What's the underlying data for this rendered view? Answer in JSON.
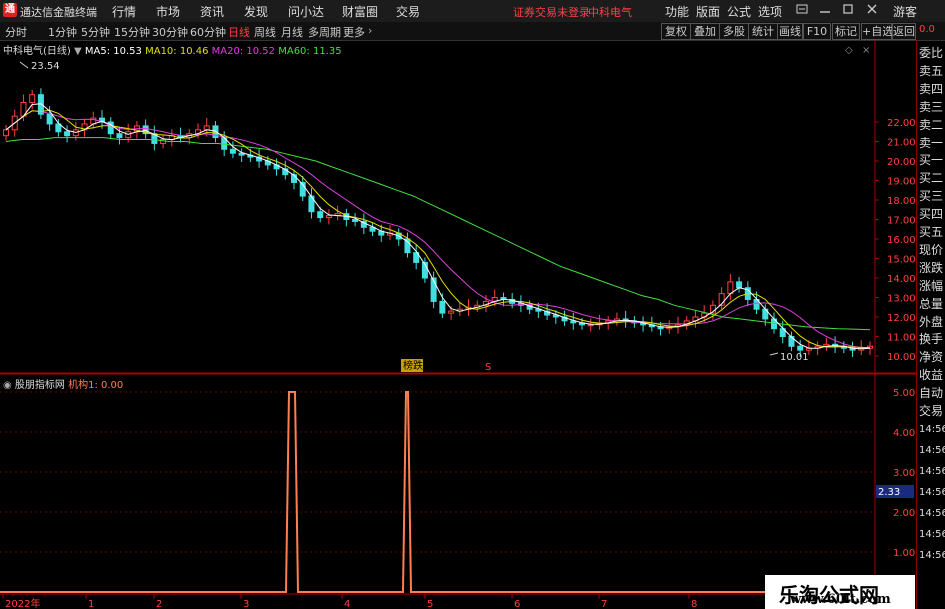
{
  "app": {
    "logo_glyph": "通",
    "name": "通达信金融终端"
  },
  "menu": [
    "行情",
    "市场",
    "资讯",
    "发现",
    "问小达",
    "财富圈",
    "交易"
  ],
  "notice": "证券交易未登录",
  "current_stock": "中科电气",
  "right_menu": [
    "功能",
    "版面",
    "公式",
    "选项"
  ],
  "guest": "游客",
  "periods": [
    "分时",
    "1分钟",
    "5分钟",
    "15分钟",
    "30分钟",
    "60分钟",
    "日线",
    "周线",
    "月线",
    "多周期",
    "更多"
  ],
  "active_period": "日线",
  "toolbar_buttons": [
    "复权",
    "叠加",
    "多股",
    "统计",
    "画线",
    "F10",
    "标记",
    "+自选",
    "返回"
  ],
  "main_chart": {
    "title": "中科电气(日线)",
    "ma": [
      {
        "label": "MA5: 10.53",
        "color": "#ffffff"
      },
      {
        "label": "MA10: 10.46",
        "color": "#e0e000"
      },
      {
        "label": "MA20: 10.52",
        "color": "#e040e0"
      },
      {
        "label": "MA60: 11.35",
        "color": "#40e040"
      }
    ],
    "high_label": "23.54",
    "low_label": "10.01",
    "tag_limit": "榜跌",
    "tag_s": "S"
  },
  "sub_chart": {
    "title": "股朋指标网",
    "value_label": "机构1: 0.00",
    "current_value": "2.33"
  },
  "right_column": {
    "top": "0.0",
    "labels": [
      "委比",
      "卖五",
      "卖四",
      "卖三",
      "卖二",
      "卖一",
      "买一",
      "买二",
      "买三",
      "买四",
      "买五",
      "现价",
      "涨跌",
      "涨幅",
      "总量",
      "外盘",
      "换手",
      "净资",
      "收益",
      "自动",
      "交易"
    ],
    "times": [
      "14:56",
      "14:56",
      "14:56",
      "14:56",
      "14:56",
      "14:56",
      "14:56"
    ]
  },
  "watermark": {
    "line1": "乐淘公式网",
    "line2": "www.60lt.com"
  },
  "chart_data": [
    {
      "type": "candlestick",
      "title": "中科电气(日线)",
      "y_ticks": [
        "22.00",
        "21.00",
        "20.00",
        "19.00",
        "18.00",
        "17.00",
        "16.00",
        "15.00",
        "14.00",
        "13.00",
        "12.00",
        "11.00",
        "10.00"
      ],
      "x_ticks": [
        "2022年",
        "1",
        "2",
        "3",
        "4",
        "5",
        "6",
        "7",
        "8"
      ],
      "series": [
        {
          "name": "MA5",
          "last": 10.53,
          "color": "#ffffff"
        },
        {
          "name": "MA10",
          "last": 10.46,
          "color": "#e0e000"
        },
        {
          "name": "MA20",
          "last": 10.52,
          "color": "#e040e0"
        },
        {
          "name": "MA60",
          "last": 11.35,
          "color": "#40e040"
        }
      ],
      "close_profile": [
        21.6,
        22.3,
        23.0,
        23.4,
        22.4,
        21.9,
        21.5,
        21.3,
        21.6,
        21.9,
        22.2,
        22.0,
        21.4,
        21.2,
        21.5,
        21.8,
        21.4,
        20.9,
        21.1,
        21.3,
        21.2,
        21.4,
        21.6,
        21.8,
        21.2,
        20.6,
        20.4,
        20.3,
        20.2,
        20.0,
        19.8,
        19.6,
        19.3,
        18.9,
        18.2,
        17.4,
        17.1,
        17.2,
        17.3,
        17.0,
        16.9,
        16.6,
        16.4,
        16.2,
        16.3,
        16.0,
        15.3,
        14.8,
        14.0,
        12.8,
        12.2,
        12.3,
        12.4,
        12.5,
        12.6,
        12.8,
        13.0,
        12.9,
        12.7,
        12.6,
        12.4,
        12.3,
        12.1,
        12.0,
        11.8,
        11.7,
        11.6,
        11.6,
        11.7,
        11.8,
        11.9,
        11.8,
        11.7,
        11.6,
        11.5,
        11.4,
        11.5,
        11.6,
        11.8,
        12.0,
        12.2,
        12.6,
        13.2,
        13.8,
        13.5,
        12.9,
        12.4,
        11.9,
        11.4,
        11.0,
        10.5,
        10.3,
        10.4,
        10.5,
        10.6,
        10.5,
        10.4,
        10.3,
        10.4,
        10.5
      ],
      "ma60_profile": [
        21.0,
        21.1,
        21.1,
        21.2,
        21.2,
        21.2,
        21.2,
        21.1,
        21.1,
        21.1,
        21.0,
        21.0,
        20.9,
        20.9,
        20.8,
        20.7,
        20.6,
        20.4,
        20.2,
        20.0,
        19.7,
        19.4,
        19.1,
        18.8,
        18.5,
        18.2,
        17.8,
        17.4,
        17.0,
        16.6,
        16.2,
        15.8,
        15.4,
        15.0,
        14.6,
        14.3,
        14.0,
        13.7,
        13.4,
        13.1,
        12.9,
        12.6,
        12.4,
        12.2,
        12.0,
        11.9,
        11.8,
        11.7,
        11.6,
        11.5,
        11.45,
        11.4,
        11.38,
        11.35
      ]
    },
    {
      "type": "line",
      "title": "股朋指标网",
      "series": [
        {
          "name": "机构1",
          "last": 0.0,
          "color": "#ff7f50"
        }
      ],
      "y_ticks": [
        "5.00",
        "4.00",
        "3.00",
        "2.00",
        "1.00"
      ],
      "current": 2.33,
      "spikes": [
        {
          "x_index": 23,
          "value": 5
        },
        {
          "x_index": 34,
          "value": 5
        }
      ]
    }
  ]
}
